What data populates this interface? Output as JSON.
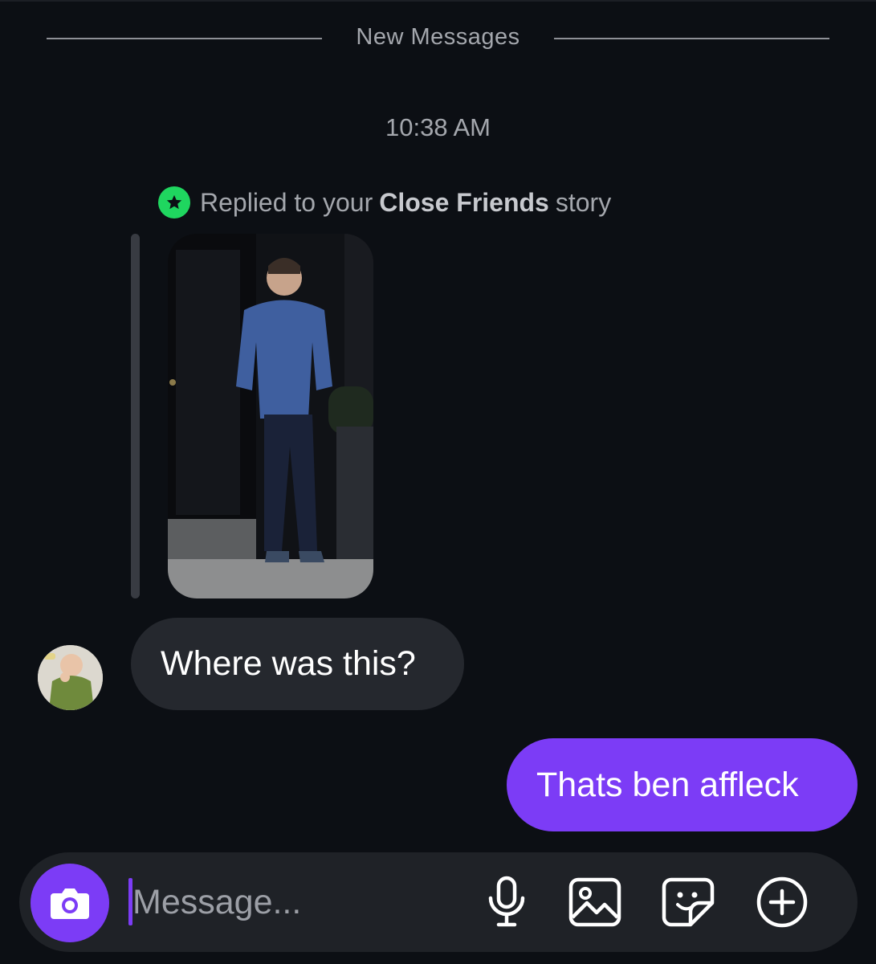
{
  "divider": {
    "label": "New Messages"
  },
  "timestamp": "10:38 AM",
  "story_reply": {
    "prefix": "Replied to your",
    "list_name": "Close Friends",
    "suffix": "story",
    "badge_icon": "star-icon",
    "badge_color": "#1fd65f"
  },
  "messages": [
    {
      "direction": "incoming",
      "text": "Where was this?"
    },
    {
      "direction": "outgoing",
      "text": "Thats ben affleck"
    }
  ],
  "composer": {
    "placeholder": "Message...",
    "camera_icon": "camera-icon",
    "tools": [
      "microphone-icon",
      "gallery-icon",
      "sticker-icon",
      "plus-circle-icon"
    ]
  },
  "colors": {
    "background": "#0c0f14",
    "accent": "#7c3cf6",
    "incoming_bubble": "#25282e",
    "composer_bg": "#1f2227"
  }
}
